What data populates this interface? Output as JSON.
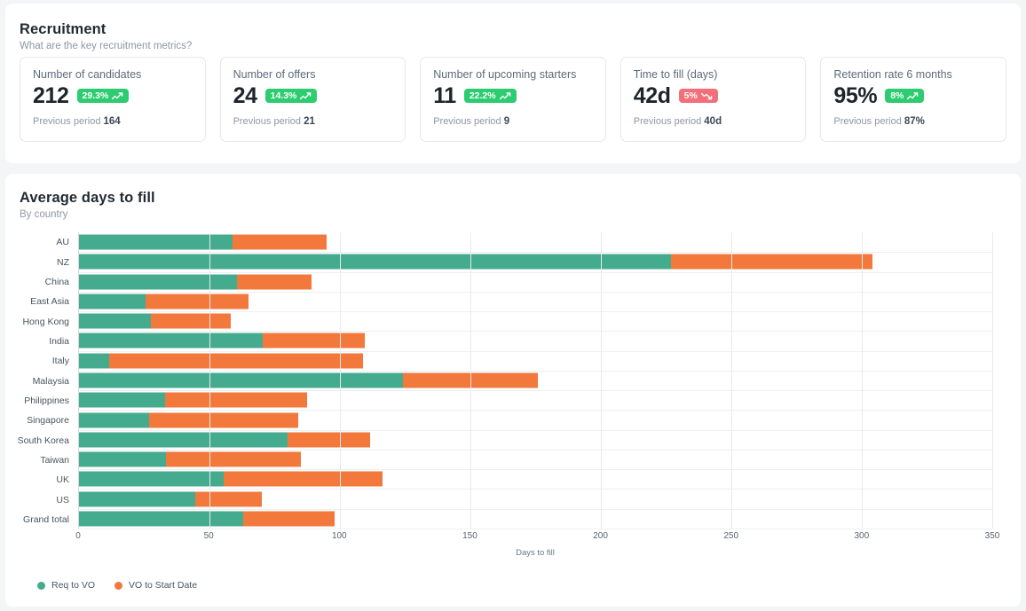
{
  "recruitment": {
    "title": "Recruitment",
    "subtitle": "What are the key recruitment metrics?",
    "cards": [
      {
        "label": "Number of candidates",
        "value": "212",
        "delta": "29.3%",
        "direction": "up",
        "prev_label": "Previous period",
        "prev_value": "164"
      },
      {
        "label": "Number of offers",
        "value": "24",
        "delta": "14.3%",
        "direction": "up",
        "prev_label": "Previous period",
        "prev_value": "21"
      },
      {
        "label": "Number of upcoming starters",
        "value": "11",
        "delta": "22.2%",
        "direction": "up",
        "prev_label": "Previous period",
        "prev_value": "9"
      },
      {
        "label": "Time to fill (days)",
        "value": "42d",
        "delta": "5%",
        "direction": "down",
        "prev_label": "Previous period",
        "prev_value": "40d"
      },
      {
        "label": "Retention rate 6 months",
        "value": "95%",
        "delta": "8%",
        "direction": "up",
        "prev_label": "Previous period",
        "prev_value": "87%"
      }
    ]
  },
  "chart_panel": {
    "title": "Average days to fill",
    "subtitle": "By country"
  },
  "colors": {
    "series_a": "#44ab8f",
    "series_b": "#f2783c",
    "badge_up": "#2ecc71",
    "badge_down": "#f2707a",
    "page_bg": "#f4f5f7",
    "panel_bg": "#ffffff"
  },
  "chart_data": {
    "type": "bar",
    "orientation": "horizontal",
    "stacked": true,
    "title": "Average days to fill",
    "subtitle": "By country",
    "xlabel": "Days to fill",
    "ylabel": "",
    "xlim": [
      0,
      350
    ],
    "xticks": [
      0,
      50,
      100,
      150,
      200,
      250,
      300,
      350
    ],
    "grid": true,
    "legend_position": "bottom-left",
    "categories": [
      "AU",
      "NZ",
      "China",
      "East Asia",
      "Hong Kong",
      "India",
      "Italy",
      "Malaysia",
      "Philippines",
      "Singapore",
      "South Korea",
      "Taiwan",
      "UK",
      "US",
      "Grand total"
    ],
    "series": [
      {
        "name": "Req to VO",
        "color": "#44ab8f",
        "values": [
          59,
          227,
          60.5,
          25.5,
          27.5,
          70.5,
          11.5,
          124,
          33,
          27,
          80,
          33.5,
          55.5,
          44.5,
          63
        ]
      },
      {
        "name": "VO to Start Date",
        "color": "#f2783c",
        "values": [
          36,
          77,
          28.5,
          39.5,
          30.5,
          39,
          97.5,
          52,
          54.5,
          57,
          31.5,
          51.5,
          61,
          25.5,
          35
        ]
      }
    ],
    "totals": [
      95,
      304,
      89,
      65,
      58,
      109.5,
      109,
      176,
      87.5,
      84,
      111.5,
      85,
      116.5,
      70,
      98
    ]
  }
}
